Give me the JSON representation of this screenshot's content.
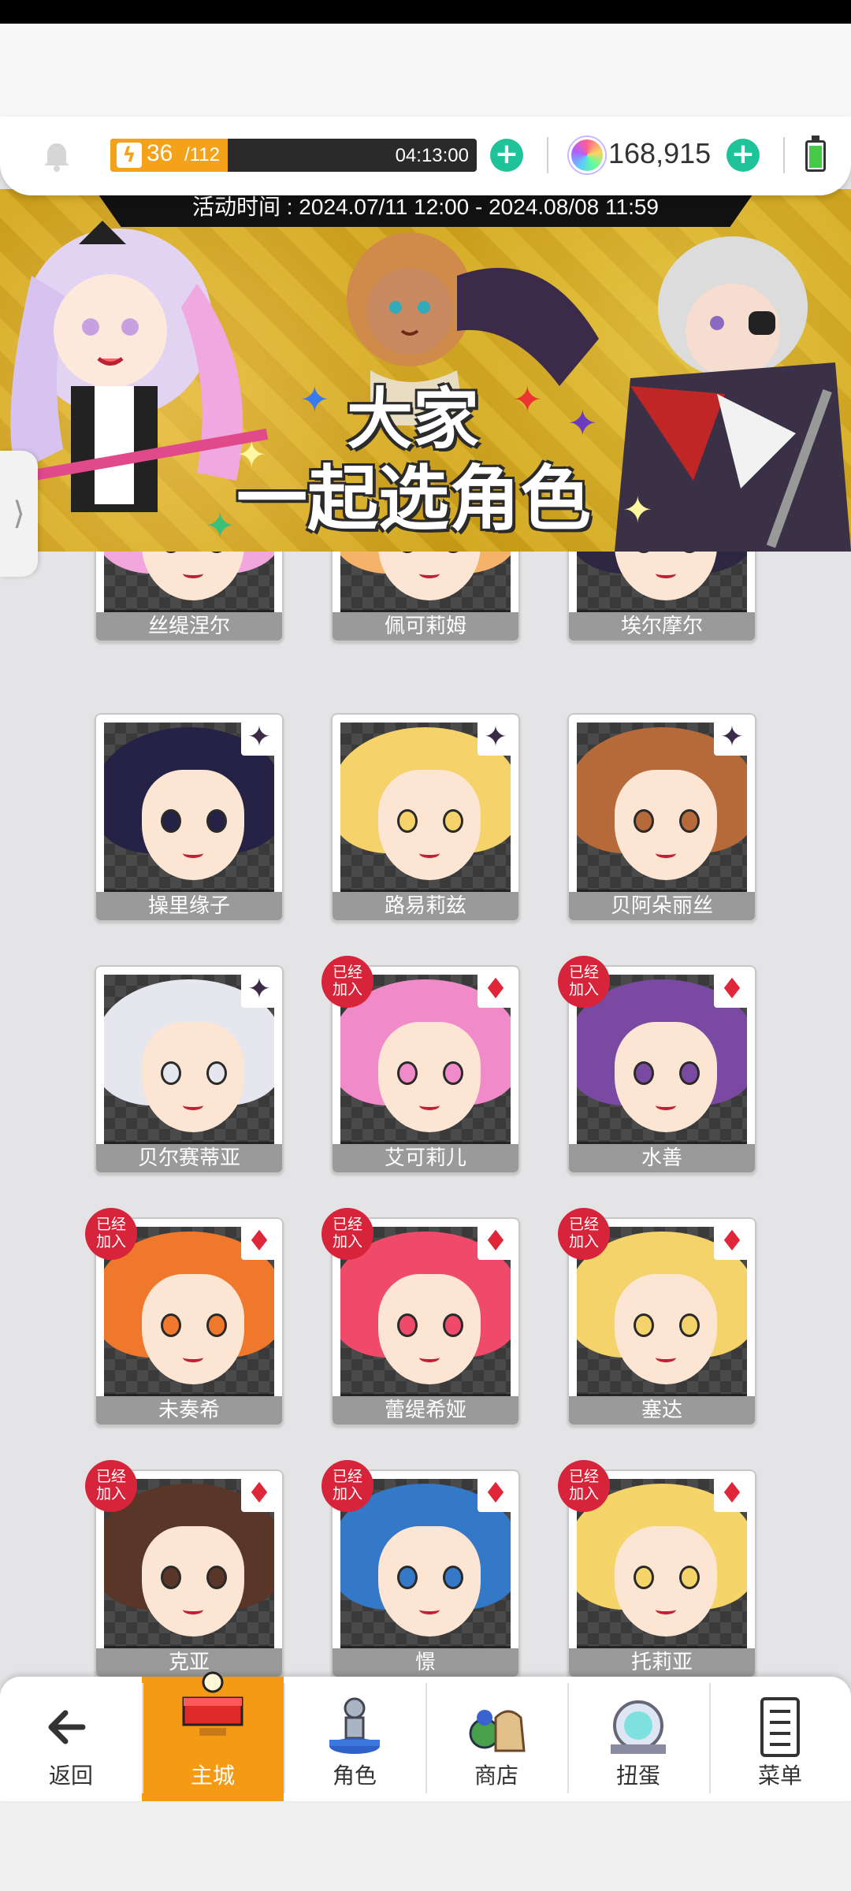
{
  "topbar": {
    "stamina_current": "36",
    "stamina_max": "/112",
    "stamina_fraction": 0.321,
    "stamina_timer": "04:13:00",
    "gems": "168,915",
    "icons": {
      "bell": "bell-icon",
      "bolt": "lightning-icon",
      "gem": "rainbow-gem-icon",
      "battery": "battery-icon"
    }
  },
  "banner": {
    "event_time": "活动时间 : 2024.07/11 12:00 - 2024.08/08 11:59",
    "title_line1": "大家",
    "title_line2": "一起选角色"
  },
  "joined_badge": "已经\n加入",
  "characters": [
    {
      "name": "丝缇涅尔",
      "stars": "★★★★★",
      "joined": false,
      "suit": "",
      "hair": "#f1a6dc"
    },
    {
      "name": "佩可莉姆",
      "stars": "★★★★★",
      "joined": false,
      "suit": "",
      "hair": "#f5b36a"
    },
    {
      "name": "埃尔摩尔",
      "stars": "★★★★★",
      "joined": false,
      "suit": "",
      "hair": "#2d2742"
    },
    {
      "name": "操里缘子",
      "stars": "★★★★★",
      "joined": false,
      "suit": "dark",
      "hair": "#252246"
    },
    {
      "name": "路易莉兹",
      "stars": "★★★★★",
      "joined": false,
      "suit": "dark",
      "hair": "#f5d26a"
    },
    {
      "name": "贝阿朵丽丝",
      "stars": "★★★★★",
      "joined": false,
      "suit": "dark",
      "hair": "#b66a3a"
    },
    {
      "name": "贝尔赛蒂亚",
      "stars": "★★★★★",
      "joined": false,
      "suit": "dark",
      "hair": "#e6e6ee"
    },
    {
      "name": "艾可莉儿",
      "stars": "★★★★★",
      "joined": true,
      "suit": "red",
      "hair": "#f08ac8"
    },
    {
      "name": "水善",
      "stars": "★★★★★",
      "joined": true,
      "suit": "red",
      "hair": "#7a4aa2"
    },
    {
      "name": "未奏希",
      "stars": "★★★★★",
      "joined": true,
      "suit": "red",
      "hair": "#f0782c"
    },
    {
      "name": "蕾缇希娅",
      "stars": "★★★★★",
      "joined": true,
      "suit": "red",
      "hair": "#f04a6a"
    },
    {
      "name": "塞达",
      "stars": "★★★★★",
      "joined": true,
      "suit": "red",
      "hair": "#f3d36a"
    },
    {
      "name": "克亚",
      "stars": "★★★★★",
      "joined": true,
      "suit": "red",
      "hair": "#5a3628"
    },
    {
      "name": "憬",
      "stars": "★★★★★",
      "joined": true,
      "suit": "red",
      "hair": "#3478c8"
    },
    {
      "name": "托莉亚",
      "stars": "★★★★★",
      "joined": true,
      "suit": "red",
      "hair": "#f5d46a"
    }
  ],
  "nav": {
    "back": "返回",
    "home": "主城",
    "characters": "角色",
    "shop": "商店",
    "gacha": "扭蛋",
    "menu": "菜单"
  },
  "colors": {
    "accent": "#f59a14",
    "plus": "#1fc39a",
    "badge": "#d8243a",
    "stamina": "#f4a21a"
  }
}
